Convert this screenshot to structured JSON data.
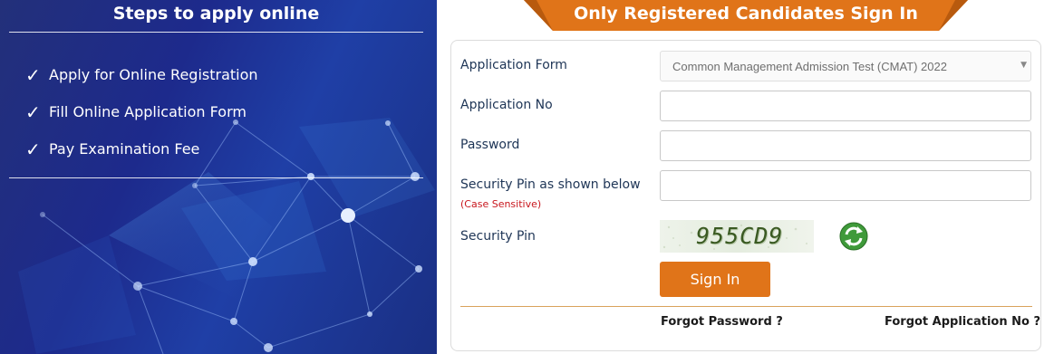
{
  "left_panel": {
    "title": "Steps to apply online",
    "steps": [
      "Apply for Online Registration",
      "Fill Online Application Form",
      "Pay Examination Fee"
    ],
    "check_icon": "check-icon"
  },
  "signin_panel": {
    "title": "Only Registered Candidates Sign In",
    "accent_color": "#e07419",
    "form": {
      "application_form_label": "Application Form",
      "application_form_value": "Common Management Admission Test (CMAT) 2022",
      "application_no_label": "Application No",
      "application_no_value": "",
      "password_label": "Password",
      "password_value": "",
      "security_pin_input_label": "Security Pin as shown below",
      "case_sensitive_note": "(Case Sensitive)",
      "security_pin_input_value": "",
      "security_pin_label": "Security Pin",
      "captcha_text": "955CD9",
      "refresh_icon": "refresh-icon",
      "signin_label": "Sign In"
    },
    "links": {
      "forgot_password": "Forgot Password ?",
      "forgot_application_no": "Forgot Application No ?"
    }
  }
}
